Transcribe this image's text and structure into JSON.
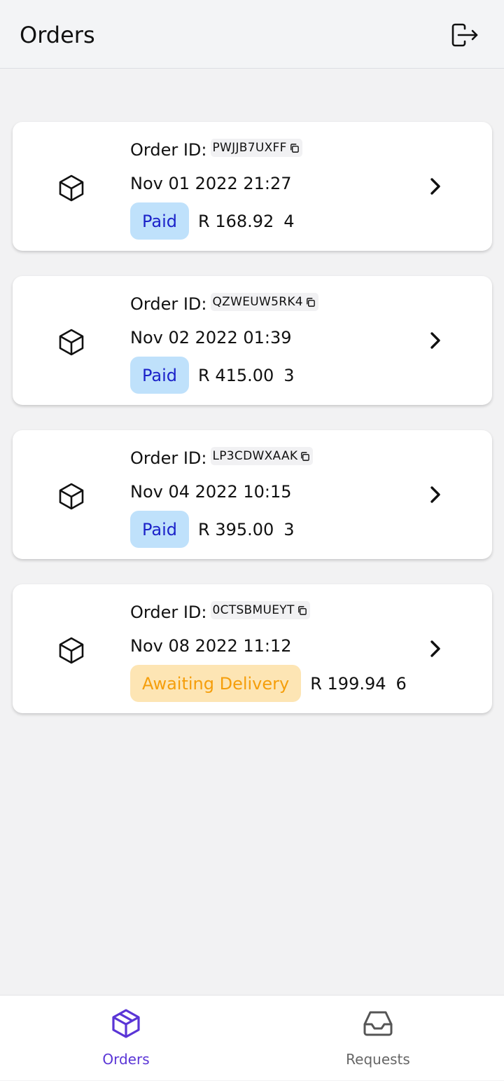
{
  "header": {
    "title": "Orders",
    "logout_icon": "logout-icon"
  },
  "orders": [
    {
      "label": "Order ID:",
      "id": "PWJJB7UXFF",
      "date": "Nov 01 2022 21:27",
      "status": "Paid",
      "status_type": "paid",
      "price": "R 168.92",
      "qty": "4"
    },
    {
      "label": "Order ID:",
      "id": "QZWEUW5RK4",
      "date": "Nov 02 2022 01:39",
      "status": "Paid",
      "status_type": "paid",
      "price": "R 415.00",
      "qty": "3"
    },
    {
      "label": "Order ID:",
      "id": "LP3CDWXAAK",
      "date": "Nov 04 2022 10:15",
      "status": "Paid",
      "status_type": "paid",
      "price": "R 395.00",
      "qty": "3"
    },
    {
      "label": "Order ID:",
      "id": "0CTSBMUEYT",
      "date": "Nov 08 2022 11:12",
      "status": "Awaiting Delivery",
      "status_type": "awaiting",
      "price": "R 199.94",
      "qty": "6"
    }
  ],
  "bottom_nav": {
    "items": [
      {
        "label": "Orders",
        "icon": "package-icon",
        "active": true
      },
      {
        "label": "Requests",
        "icon": "inbox-icon",
        "active": false
      }
    ]
  },
  "colors": {
    "accent": "#5a35d6",
    "paid_bg": "#bfe1fb",
    "paid_text": "#1c23c9",
    "awaiting_bg": "#fde5b4",
    "awaiting_text": "#f59e0b"
  }
}
